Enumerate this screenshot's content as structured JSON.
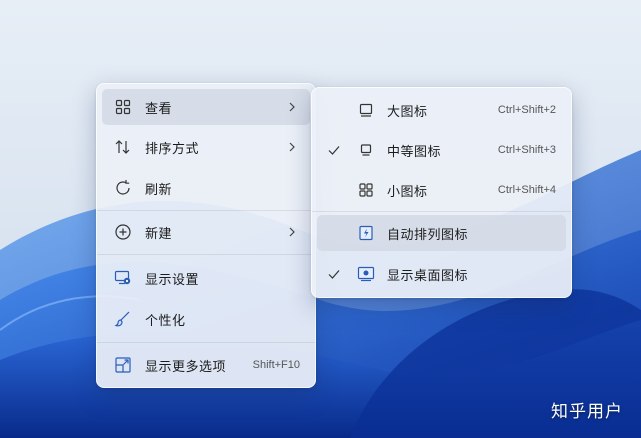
{
  "main_menu": {
    "items": [
      {
        "label": "查看",
        "icon": "grid-icon",
        "submenu": true
      },
      {
        "label": "排序方式",
        "icon": "sort-icon",
        "submenu": true
      },
      {
        "label": "刷新",
        "icon": "refresh-icon"
      },
      {
        "label": "新建",
        "icon": "plus-circle-icon",
        "submenu": true
      },
      {
        "label": "显示设置",
        "icon": "display-settings-icon"
      },
      {
        "label": "个性化",
        "icon": "brush-icon"
      },
      {
        "label": "显示更多选项",
        "icon": "open-more-icon",
        "shortcut": "Shift+F10"
      }
    ]
  },
  "view_submenu": {
    "items": [
      {
        "label": "大图标",
        "shortcut": "Ctrl+Shift+2",
        "checked": false,
        "icon": "large-icons-icon"
      },
      {
        "label": "中等图标",
        "shortcut": "Ctrl+Shift+3",
        "checked": true,
        "icon": "medium-icons-icon"
      },
      {
        "label": "小图标",
        "shortcut": "Ctrl+Shift+4",
        "checked": false,
        "icon": "small-icons-icon"
      },
      {
        "label": "自动排列图标",
        "checked": false,
        "icon": "auto-arrange-icon"
      },
      {
        "label": "显示桌面图标",
        "checked": true,
        "icon": "show-desktop-icons-icon"
      }
    ]
  },
  "watermark": "知乎用户",
  "colors": {
    "accent": "#1a5fd0",
    "menu_bg": "#ecf0f7",
    "hover_bg": "#d2d9e5"
  }
}
